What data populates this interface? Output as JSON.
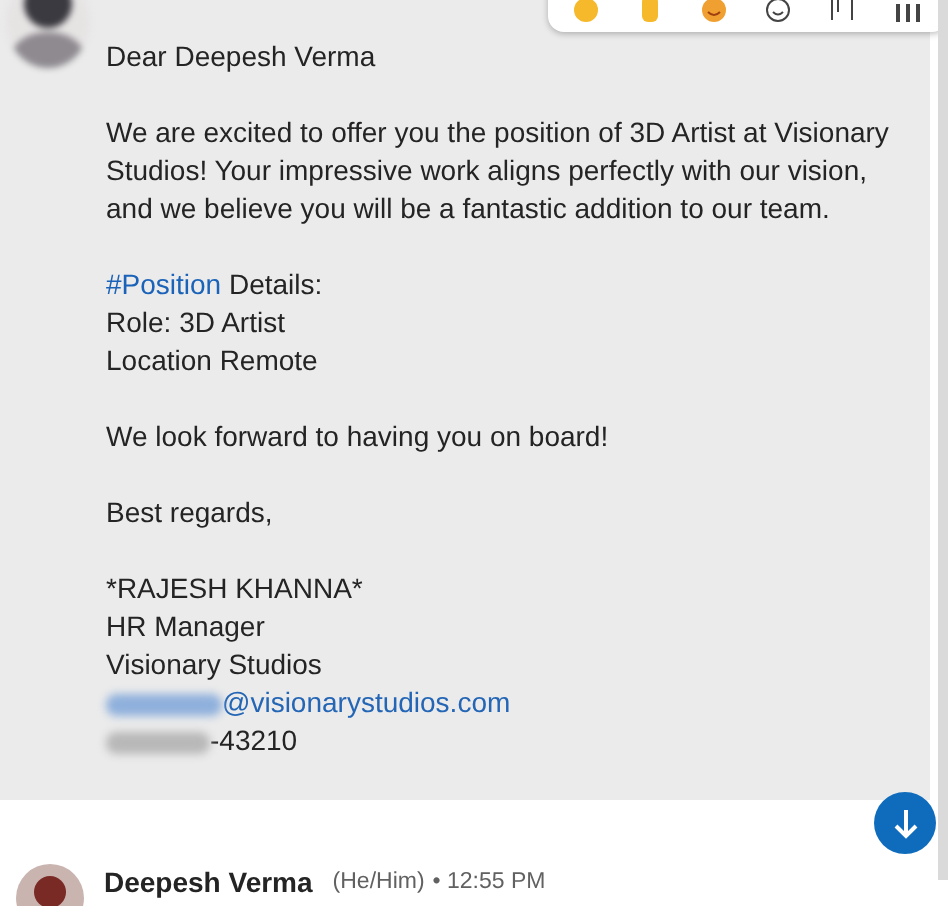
{
  "message": {
    "lines": [
      {
        "kind": "text",
        "text": "Dear Deepesh Verma"
      },
      {
        "kind": "gap"
      },
      {
        "kind": "text",
        "text": "We are excited to offer you the position of 3D Artist at Visionary Studios! Your impressive work aligns perfectly with our vision, and we believe you will be a fantastic addition to our team."
      },
      {
        "kind": "gap"
      },
      {
        "kind": "hashtag",
        "tag": "#Position",
        "text": " Details:"
      },
      {
        "kind": "text",
        "text": "Role: 3D Artist"
      },
      {
        "kind": "text",
        "text": "Location Remote"
      },
      {
        "kind": "gap"
      },
      {
        "kind": "text",
        "text": "We look forward to having you on board!"
      },
      {
        "kind": "gap"
      },
      {
        "kind": "text",
        "text": "Best regards,"
      },
      {
        "kind": "gap"
      },
      {
        "kind": "text",
        "text": "*RAJESH KHANNA*"
      },
      {
        "kind": "text",
        "text": "HR Manager"
      },
      {
        "kind": "text",
        "text": "Visionary Studios"
      },
      {
        "kind": "email",
        "text": "@visionarystudios.com"
      },
      {
        "kind": "phone",
        "text": "-43210"
      }
    ]
  },
  "next_message": {
    "sender": "Deepesh Verma",
    "pronouns": "(He/Him)",
    "time": "• 12:55 PM"
  }
}
